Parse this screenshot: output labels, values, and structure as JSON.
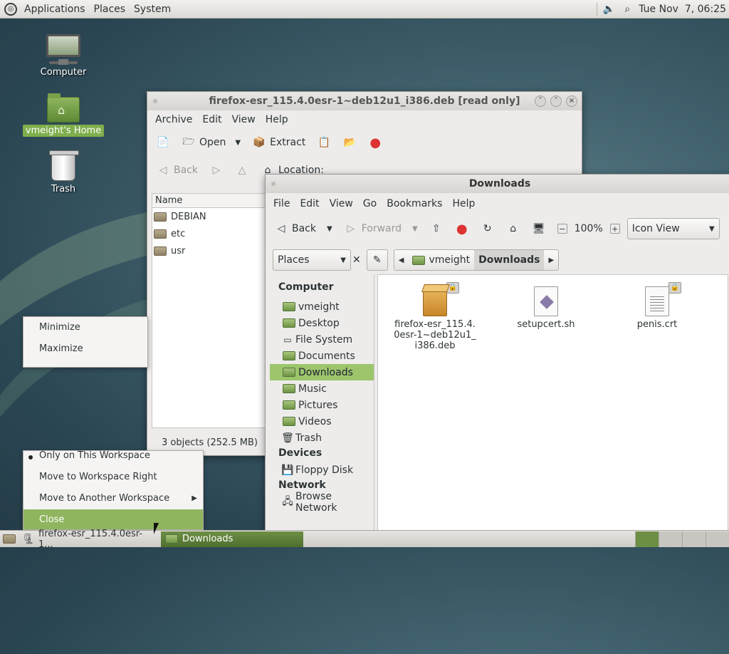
{
  "top_panel": {
    "menus": [
      "Applications",
      "Places",
      "System"
    ],
    "clock": "Tue Nov  7, 06:25"
  },
  "desktop": {
    "icons": [
      {
        "label": "Computer"
      },
      {
        "label": "vmeight's Home"
      },
      {
        "label": "Trash"
      }
    ]
  },
  "archive_window": {
    "title": "firefox-esr_115.4.0esr-1~deb12u1_i386.deb [read only]",
    "menu": [
      "Archive",
      "Edit",
      "View",
      "Help"
    ],
    "toolbar": {
      "open": "Open",
      "extract": "Extract"
    },
    "nav": {
      "back": "Back",
      "location": "Location:"
    },
    "column_name": "Name",
    "files": [
      "DEBIAN",
      "etc",
      "usr"
    ],
    "status": "3 objects (252.5 MB)"
  },
  "downloads_window": {
    "title": "Downloads",
    "menu": [
      "File",
      "Edit",
      "View",
      "Go",
      "Bookmarks",
      "Help"
    ],
    "toolbar": {
      "back": "Back",
      "forward": "Forward",
      "zoom": "100%",
      "view_mode": "Icon View"
    },
    "places_label": "Places",
    "breadcrumb": [
      "vmeight",
      "Downloads"
    ],
    "sidebar": {
      "computer_heading": "Computer",
      "computer_items": [
        "vmeight",
        "Desktop",
        "File System",
        "Documents",
        "Downloads",
        "Music",
        "Pictures",
        "Videos",
        "Trash"
      ],
      "devices_heading": "Devices",
      "devices_items": [
        "Floppy Disk"
      ],
      "network_heading": "Network",
      "network_items": [
        "Browse Network"
      ]
    },
    "files": [
      {
        "name": "firefox-esr_115.4.0esr-1~deb12u1_i386.deb",
        "line1": "firefox-esr_115.4.",
        "line2": "0esr-1~deb12u1_",
        "line3": "i386.deb"
      },
      {
        "name": "setupcert.sh"
      },
      {
        "name": "penis.crt"
      }
    ]
  },
  "context_menu_top": {
    "items": [
      "Minimize",
      "Maximize"
    ]
  },
  "context_menu_bottom": {
    "items": [
      "Only on This Workspace",
      "Move to Workspace Right",
      "Move to Another Workspace",
      "Close"
    ]
  },
  "taskbar": {
    "tasks": [
      "firefox-esr_115.4.0esr-1...",
      "Downloads"
    ]
  },
  "colors": {
    "accent": "#8fb55f",
    "selection": "#9cc56c"
  }
}
